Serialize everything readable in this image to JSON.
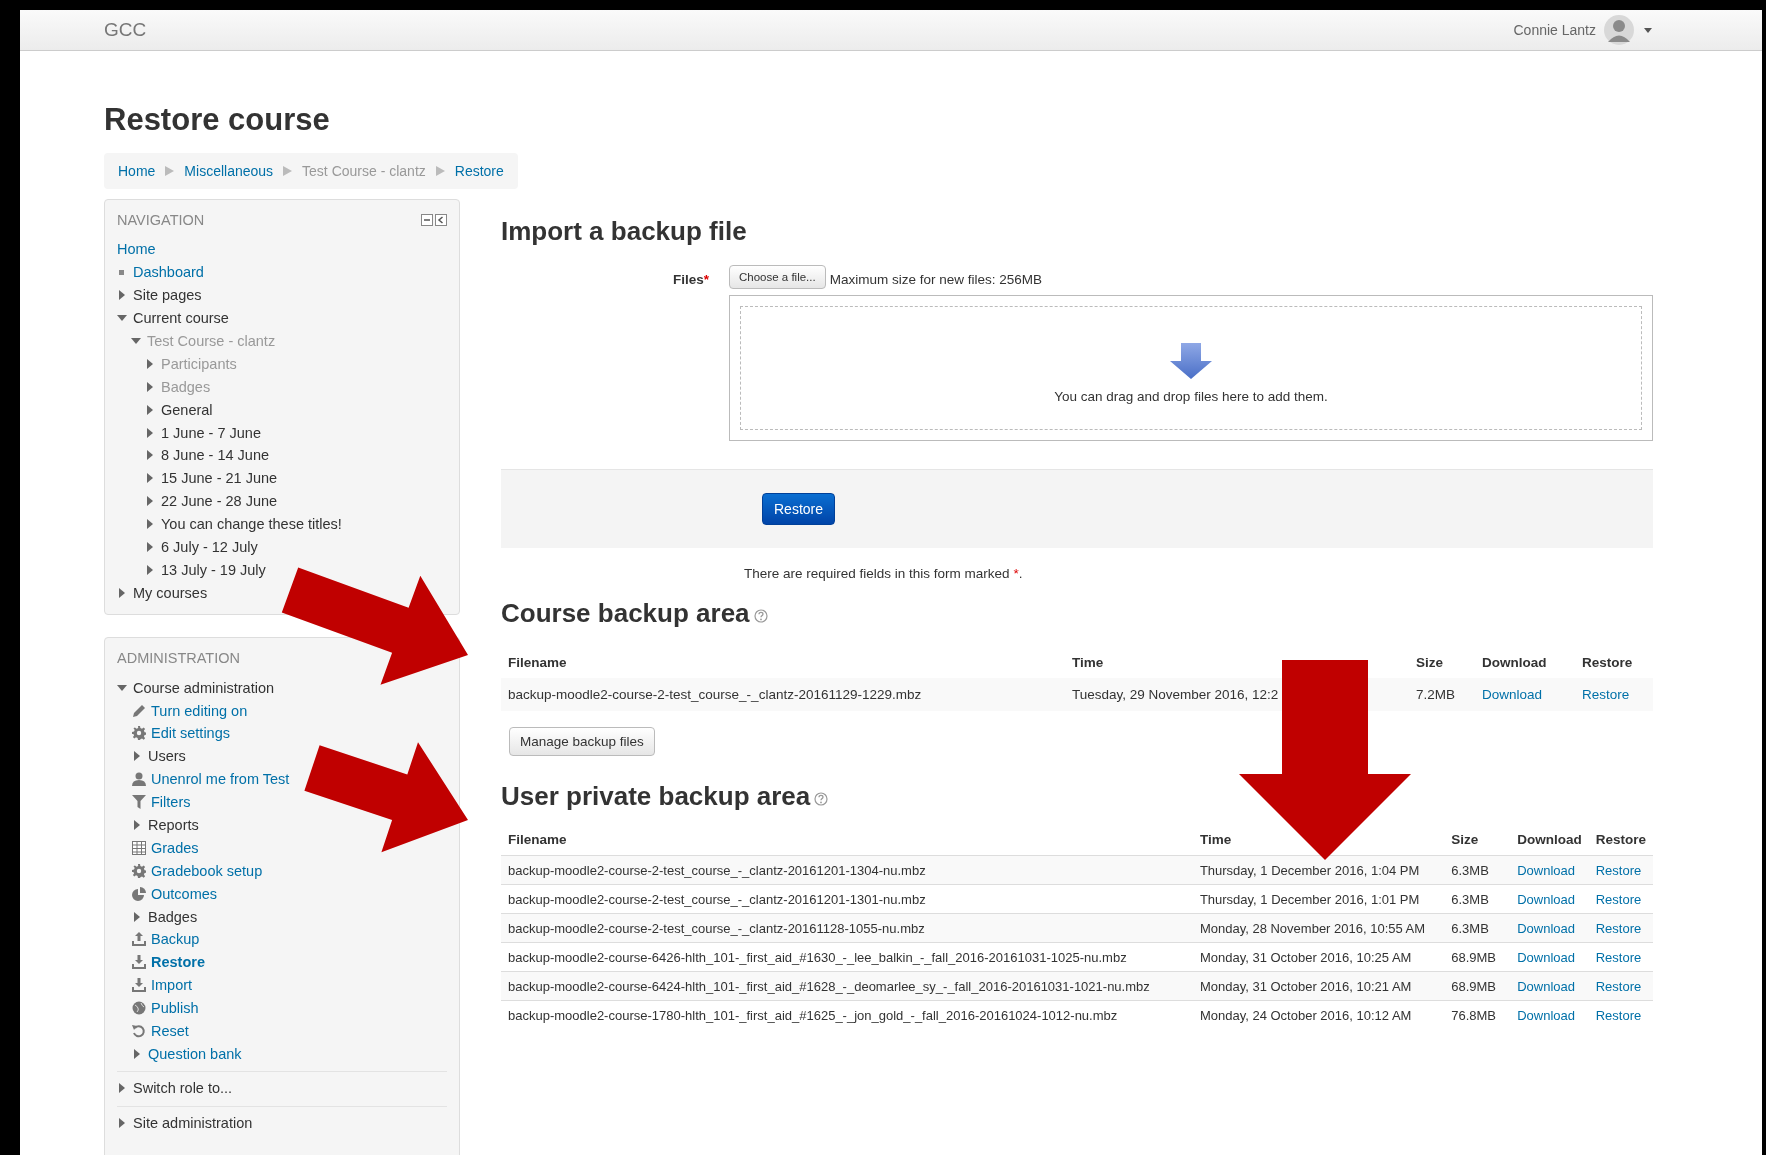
{
  "header": {
    "site_name": "GCC",
    "user_name": "Connie Lantz"
  },
  "page_title": "Restore course",
  "breadcrumb": [
    {
      "label": "Home",
      "kind": "link"
    },
    {
      "label": "Miscellaneous",
      "kind": "link"
    },
    {
      "label": "Test Course - clantz",
      "kind": "text"
    },
    {
      "label": "Restore",
      "kind": "link"
    }
  ],
  "navigation": {
    "title": "NAVIGATION",
    "items": [
      {
        "label": "Home",
        "kind": "plain",
        "link": true,
        "dimmed": false
      },
      {
        "label": "Dashboard",
        "kind": "bullet",
        "link": true,
        "dimmed": false
      },
      {
        "label": "Site pages",
        "kind": "toggle",
        "expanded": false,
        "link": false,
        "dimmed": false
      },
      {
        "label": "Current course",
        "kind": "toggle",
        "expanded": true,
        "link": false,
        "dimmed": false,
        "children": [
          {
            "label": "Test Course - clantz",
            "kind": "toggle",
            "expanded": true,
            "dimmed": true,
            "children": [
              {
                "label": "Participants",
                "kind": "toggle",
                "expanded": false,
                "dimmed": true
              },
              {
                "label": "Badges",
                "kind": "toggle",
                "expanded": false,
                "dimmed": true
              },
              {
                "label": "General",
                "kind": "toggle",
                "expanded": false,
                "link": false,
                "dimmed": false
              },
              {
                "label": "1 June - 7 June",
                "kind": "toggle",
                "expanded": false,
                "link": false,
                "dimmed": false
              },
              {
                "label": "8 June - 14 June",
                "kind": "toggle",
                "expanded": false,
                "link": false,
                "dimmed": false
              },
              {
                "label": "15 June - 21 June",
                "kind": "toggle",
                "expanded": false,
                "link": false,
                "dimmed": false
              },
              {
                "label": "22 June - 28 June",
                "kind": "toggle",
                "expanded": false,
                "link": false,
                "dimmed": false
              },
              {
                "label": "You can change these titles!",
                "kind": "toggle",
                "expanded": false,
                "link": false,
                "dimmed": false
              },
              {
                "label": "6 July - 12 July",
                "kind": "toggle",
                "expanded": false,
                "link": false,
                "dimmed": false
              },
              {
                "label": "13 July - 19 July",
                "kind": "toggle",
                "expanded": false,
                "link": false,
                "dimmed": false
              }
            ]
          }
        ]
      },
      {
        "label": "My courses",
        "kind": "toggle",
        "expanded": false,
        "link": false,
        "dimmed": false
      }
    ]
  },
  "administration": {
    "title": "ADMINISTRATION",
    "items": [
      {
        "label": "Course administration",
        "kind": "toggle",
        "expanded": true,
        "link": false,
        "current": false,
        "children": [
          {
            "label": "Turn editing on",
            "kind": "pencil",
            "link": true,
            "current": false
          },
          {
            "label": "Edit settings",
            "kind": "gear",
            "link": true,
            "current": false
          },
          {
            "label": "Users",
            "kind": "toggle",
            "expanded": false,
            "link": false,
            "current": false
          },
          {
            "label": "Unenrol me from Test",
            "kind": "person",
            "link": true,
            "current": false
          },
          {
            "label": "Filters",
            "kind": "funnel",
            "link": true,
            "current": false
          },
          {
            "label": "Reports",
            "kind": "toggle",
            "expanded": false,
            "link": false,
            "current": false
          },
          {
            "label": "Grades",
            "kind": "table",
            "link": true,
            "current": false
          },
          {
            "label": "Gradebook setup",
            "kind": "gear",
            "link": true,
            "current": false
          },
          {
            "label": "Outcomes",
            "kind": "pie",
            "link": true,
            "current": false
          },
          {
            "label": "Badges",
            "kind": "toggle",
            "expanded": false,
            "link": false,
            "current": false
          },
          {
            "label": "Backup",
            "kind": "upload",
            "link": true,
            "current": false
          },
          {
            "label": "Restore",
            "kind": "download",
            "link": true,
            "current": true
          },
          {
            "label": "Import",
            "kind": "download",
            "link": true,
            "current": false
          },
          {
            "label": "Publish",
            "kind": "globe",
            "link": true,
            "current": false
          },
          {
            "label": "Reset",
            "kind": "reset",
            "link": true,
            "current": false
          },
          {
            "label": "Question bank",
            "kind": "toggle",
            "expanded": false,
            "link": true,
            "current": false
          }
        ]
      },
      {
        "label": "Switch role to...",
        "kind": "toggle",
        "expanded": false,
        "link": false,
        "current": false
      },
      {
        "label": "Site administration",
        "kind": "toggle",
        "expanded": false,
        "link": false,
        "current": false
      }
    ]
  },
  "import": {
    "heading": "Import a backup file",
    "files_label": "Files",
    "required_mark": "*",
    "choose_button": "Choose a file...",
    "max_size": "Maximum size for new files: 256MB",
    "drop_text": "You can drag and drop files here to add them.",
    "submit": "Restore"
  },
  "required_note": {
    "text": "There are required fields in this form marked",
    "mark": "*",
    "end": "."
  },
  "course_backup": {
    "heading": "Course backup area",
    "columns": [
      "Filename",
      "Time",
      "Size",
      "Download",
      "Restore"
    ],
    "rows": [
      {
        "filename": "backup-moodle2-course-2-test_course_-_clantz-20161129-1229.mbz",
        "time": "Tuesday, 29 November 2016, 12:2",
        "size": "7.2MB",
        "download": "Download",
        "restore": "Restore"
      }
    ],
    "manage_button": "Manage backup files"
  },
  "user_backup": {
    "heading": "User private backup area",
    "columns": [
      "Filename",
      "Time",
      "Size",
      "Download",
      "Restore"
    ],
    "rows": [
      {
        "filename": "backup-moodle2-course-2-test_course_-_clantz-20161201-1304-nu.mbz",
        "time": "Thursday, 1 December 2016, 1:04 PM",
        "size": "6.3MB",
        "download": "Download",
        "restore": "Restore"
      },
      {
        "filename": "backup-moodle2-course-2-test_course_-_clantz-20161201-1301-nu.mbz",
        "time": "Thursday, 1 December 2016, 1:01 PM",
        "size": "6.3MB",
        "download": "Download",
        "restore": "Restore"
      },
      {
        "filename": "backup-moodle2-course-2-test_course_-_clantz-20161128-1055-nu.mbz",
        "time": "Monday, 28 November 2016, 10:55 AM",
        "size": "6.3MB",
        "download": "Download",
        "restore": "Restore"
      },
      {
        "filename": "backup-moodle2-course-6426-hlth_101-_first_aid_#1630_-_lee_balkin_-_fall_2016-20161031-1025-nu.mbz",
        "time": "Monday, 31 October 2016, 10:25 AM",
        "size": "68.9MB",
        "download": "Download",
        "restore": "Restore"
      },
      {
        "filename": "backup-moodle2-course-6424-hlth_101-_first_aid_#1628_-_deomarlee_sy_-_fall_2016-20161031-1021-nu.mbz",
        "time": "Monday, 31 October 2016, 10:21 AM",
        "size": "68.9MB",
        "download": "Download",
        "restore": "Restore"
      },
      {
        "filename": "backup-moodle2-course-1780-hlth_101-_first_aid_#1625_-_jon_gold_-_fall_2016-20161024-1012-nu.mbz",
        "time": "Monday, 24 October 2016, 10:12 AM",
        "size": "76.8MB",
        "download": "Download",
        "restore": "Restore"
      }
    ]
  }
}
